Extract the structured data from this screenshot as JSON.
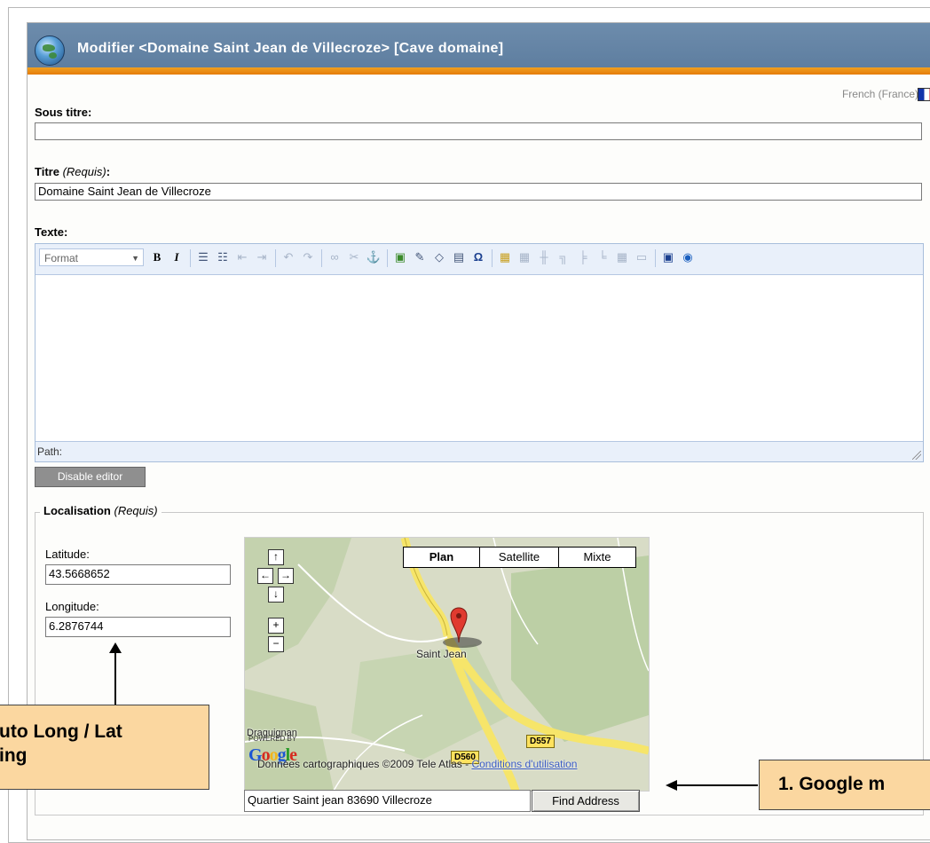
{
  "window": {
    "title": "Modifier <Domaine Saint Jean de Villecroze> [Cave domaine]",
    "language": "French (France)"
  },
  "form": {
    "subtitle_label": "Sous titre:",
    "subtitle_value": "",
    "title_label": "Titre",
    "title_required": "(Requis)",
    "title_colon": ":",
    "title_value": "Domaine Saint Jean de Villecroze",
    "text_label": "Texte:"
  },
  "editor": {
    "format_select": "Format",
    "path_label": "Path:",
    "disable_button": "Disable editor",
    "toolbar_icons": [
      "bold-icon",
      "italic-icon",
      "bullet-list-icon",
      "numbered-list-icon",
      "outdent-icon",
      "indent-icon",
      "undo-icon",
      "redo-icon",
      "link-icon",
      "unlink-icon",
      "anchor-icon",
      "image-icon",
      "attachment-icon",
      "html-icon",
      "document-icon",
      "special-char-icon",
      "table-edit-icon",
      "table-icon",
      "split-cell-icon",
      "merge-cell-icon",
      "insert-row-icon",
      "delete-row-icon",
      "table-props-icon",
      "cell-props-icon",
      "preview-icon",
      "help-icon"
    ]
  },
  "localisation": {
    "legend": "Localisation",
    "legend_required": "(Requis)",
    "latitude_label": "Latitude:",
    "latitude_value": "43.5668652",
    "longitude_label": "Longitude:",
    "longitude_value": "6.2876744"
  },
  "map": {
    "types": [
      "Plan",
      "Satellite",
      "Mixte"
    ],
    "selected_type": "Plan",
    "place_name": "Saint Jean",
    "place_name_2": "Draguignan",
    "road_1": "D557",
    "road_2": "D560",
    "powered_by": "POWERED BY",
    "logo": "Google",
    "copyright": "Données cartographiques ©2009 Tele Atlas - ",
    "terms_link": "Conditions d'utilisation",
    "address_value": "Quartier Saint jean 83690 Villecroze",
    "find_button": "Find Address",
    "colors": {
      "land": "#c9d4b4",
      "road": "#f6e56a",
      "marker": "#e03a2f"
    }
  },
  "callouts": {
    "left_text_line1": "uto Long / Lat",
    "left_text_line2": "ing",
    "right_text": "1. Google m",
    "background": "#fbd7a0"
  }
}
